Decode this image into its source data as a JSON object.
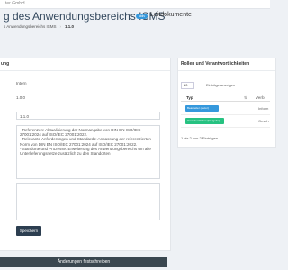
{
  "header": {
    "org_name": "ter GmbH",
    "title": "g des Anwendungsbereichs ISMS",
    "badge": "aktiv",
    "subtitle": "Leitdokumente"
  },
  "breadcrumb": {
    "item1": "s Anwendungsbereichs ISMS",
    "sep": "›",
    "current": "1.1.0"
  },
  "left_panel": {
    "heading": "ung",
    "status_value": "Intern",
    "version_value": "1.0.0",
    "version_input": "1.1.0",
    "change_notes": "- Referenzen: Aktualisierung der Normangabe von DIN EN ISO/IEC 27001:2024 auf ISO/IEC 27001:2022.\n- Relevante Anforderungen und Standards: Anpassung der referenzierten Norm von DIN EN ISO/IEC 27001:2024 auf ISO/IEC 27001:2022.\n- Standorte und Prozesse: Erweiterung des Anwendungsbereichs um alle Unterlieferungsnetze zusätzlich zu den Standorten",
    "notes_placeholder": "",
    "save_button": "Speichern"
  },
  "bottom_bar": {
    "label": "Änderungen festschreiben"
  },
  "right_panel": {
    "heading": "Rollen und Verantwortlichkeiten",
    "entries_value": "10",
    "entries_label": "Einträge anzeigen",
    "columns": [
      "Typ",
      "Verb"
    ],
    "rows": [
      {
        "type": "Bearbeiter (Autor)",
        "value": "Inform"
      },
      {
        "type": "Verantwortlicher (Freigabe)",
        "value": "Gesch"
      }
    ],
    "footer": "1 bis 2 von 2 Einträgen"
  },
  "colors": {
    "primary_blue": "#3598dc",
    "green": "#26c281",
    "dark_button": "#2c3e50",
    "bottom_bar": "#3a4750"
  }
}
